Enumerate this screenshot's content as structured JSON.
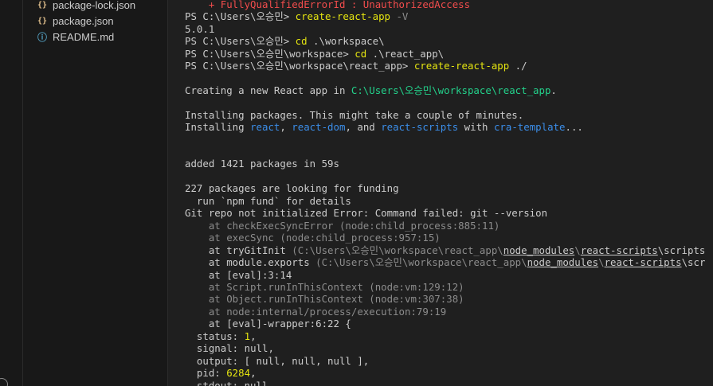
{
  "explorer": {
    "files": [
      {
        "icon": "{}",
        "name": "package-lock.json"
      },
      {
        "icon": "{}",
        "name": "package.json"
      },
      {
        "icon": "ⓘ",
        "name": "README.md"
      }
    ]
  },
  "terminal": {
    "lines": [
      {
        "id": "error-id",
        "segs": [
          {
            "t": "    + FullyQualifiedErrorId : UnauthorizedAccess",
            "c": "err"
          }
        ]
      },
      {
        "id": "cmd-version",
        "segs": [
          {
            "t": "PS C:\\Users\\오승민> ",
            "c": "prompt"
          },
          {
            "t": "create-react-app",
            "c": "cmd"
          },
          {
            "t": " -V",
            "c": "flag"
          }
        ]
      },
      {
        "id": "version-out",
        "segs": [
          {
            "t": "5.0.1",
            "c": ""
          }
        ]
      },
      {
        "id": "cmd-cd-workspace",
        "segs": [
          {
            "t": "PS C:\\Users\\오승민> ",
            "c": "prompt"
          },
          {
            "t": "cd",
            "c": "cmd"
          },
          {
            "t": " .\\workspace\\",
            "c": ""
          }
        ]
      },
      {
        "id": "cmd-cd-app",
        "segs": [
          {
            "t": "PS C:\\Users\\오승민\\workspace> ",
            "c": "prompt"
          },
          {
            "t": "cd",
            "c": "cmd"
          },
          {
            "t": " .\\react_app\\",
            "c": ""
          }
        ]
      },
      {
        "id": "cmd-create",
        "segs": [
          {
            "t": "PS C:\\Users\\오승민\\workspace\\react_app> ",
            "c": "prompt"
          },
          {
            "t": "create-react-app",
            "c": "cmd"
          },
          {
            "t": " ./",
            "c": ""
          }
        ]
      },
      {
        "id": "creating",
        "segs": [
          {
            "t": "Creating a new React app in ",
            "c": ""
          },
          {
            "t": "C:\\Users\\오승민\\workspace\\react_app",
            "c": "path"
          },
          {
            "t": ".",
            "c": ""
          }
        ]
      },
      {
        "id": "installing-1",
        "segs": [
          {
            "t": "Installing packages. This might take a couple of minutes.",
            "c": ""
          }
        ]
      },
      {
        "id": "installing-2",
        "segs": [
          {
            "t": "Installing ",
            "c": ""
          },
          {
            "t": "react",
            "c": "pkg"
          },
          {
            "t": ", ",
            "c": ""
          },
          {
            "t": "react-dom",
            "c": "pkg"
          },
          {
            "t": ", and ",
            "c": ""
          },
          {
            "t": "react-scripts",
            "c": "pkg"
          },
          {
            "t": " with ",
            "c": ""
          },
          {
            "t": "cra-template",
            "c": "pkg"
          },
          {
            "t": "...",
            "c": ""
          }
        ]
      },
      {
        "id": "added",
        "segs": [
          {
            "t": "added 1421 packages in 59s",
            "c": ""
          }
        ]
      },
      {
        "id": "funding-1",
        "segs": [
          {
            "t": "227 packages are looking for funding",
            "c": ""
          }
        ]
      },
      {
        "id": "funding-2",
        "segs": [
          {
            "t": "  run `npm fund` for details",
            "c": ""
          }
        ]
      },
      {
        "id": "git-error",
        "segs": [
          {
            "t": "Git repo not initialized Error: Command failed: git --version",
            "c": ""
          }
        ]
      },
      {
        "id": "stack-1",
        "segs": [
          {
            "t": "    at checkExecSyncError (node:child_process:885:11)",
            "c": "dim"
          }
        ]
      },
      {
        "id": "stack-2",
        "segs": [
          {
            "t": "    at execSync (node:child_process:957:15)",
            "c": "dim"
          }
        ]
      },
      {
        "id": "stack-3",
        "segs": [
          {
            "t": "    at tryGitInit ",
            "c": ""
          },
          {
            "t": "(C:\\Users\\오승민\\workspace\\react_app\\",
            "c": "dim"
          },
          {
            "t": "node_modules",
            "c": "ul"
          },
          {
            "t": "\\",
            "c": "dim"
          },
          {
            "t": "react-scripts",
            "c": "ul"
          },
          {
            "t": "\\scripts",
            "c": ""
          }
        ]
      },
      {
        "id": "stack-4",
        "segs": [
          {
            "t": "    at module.exports ",
            "c": ""
          },
          {
            "t": "(C:\\Users\\오승민\\workspace\\react_app\\",
            "c": "dim"
          },
          {
            "t": "node_modules",
            "c": "ul"
          },
          {
            "t": "\\",
            "c": "dim"
          },
          {
            "t": "react-scripts",
            "c": "ul"
          },
          {
            "t": "\\scr",
            "c": ""
          }
        ]
      },
      {
        "id": "stack-5",
        "segs": [
          {
            "t": "    at [eval]:3:14",
            "c": ""
          }
        ]
      },
      {
        "id": "stack-6",
        "segs": [
          {
            "t": "    at Script.runInThisContext (node:vm:129:12)",
            "c": "dim"
          }
        ]
      },
      {
        "id": "stack-7",
        "segs": [
          {
            "t": "    at Object.runInThisContext (node:vm:307:38)",
            "c": "dim"
          }
        ]
      },
      {
        "id": "stack-8",
        "segs": [
          {
            "t": "    at node:internal/process/execution:79:19",
            "c": "dim"
          }
        ]
      },
      {
        "id": "stack-9",
        "segs": [
          {
            "t": "    at [eval]-wrapper:6:22 {",
            "c": ""
          }
        ]
      },
      {
        "id": "status",
        "segs": [
          {
            "t": "  status: ",
            "c": ""
          },
          {
            "t": "1",
            "c": "num"
          },
          {
            "t": ",",
            "c": ""
          }
        ]
      },
      {
        "id": "signal",
        "segs": [
          {
            "t": "  signal: ",
            "c": ""
          },
          {
            "t": "null",
            "c": ""
          },
          {
            "t": ",",
            "c": ""
          }
        ]
      },
      {
        "id": "output",
        "segs": [
          {
            "t": "  output: [ null, null, null ],",
            "c": ""
          }
        ]
      },
      {
        "id": "pid",
        "segs": [
          {
            "t": "  pid: ",
            "c": ""
          },
          {
            "t": "6284",
            "c": "num"
          },
          {
            "t": ",",
            "c": ""
          }
        ]
      },
      {
        "id": "stdout",
        "segs": [
          {
            "t": "  stdout: null,",
            "c": ""
          }
        ]
      }
    ]
  },
  "colors": {
    "background": "#1f1f1f",
    "sidebar": "#181818",
    "text": "#cccccc",
    "command": "#e5e510",
    "path": "#23d18b",
    "package": "#3b8eea",
    "error": "#f14c4c",
    "dim": "#8c8c8c"
  }
}
